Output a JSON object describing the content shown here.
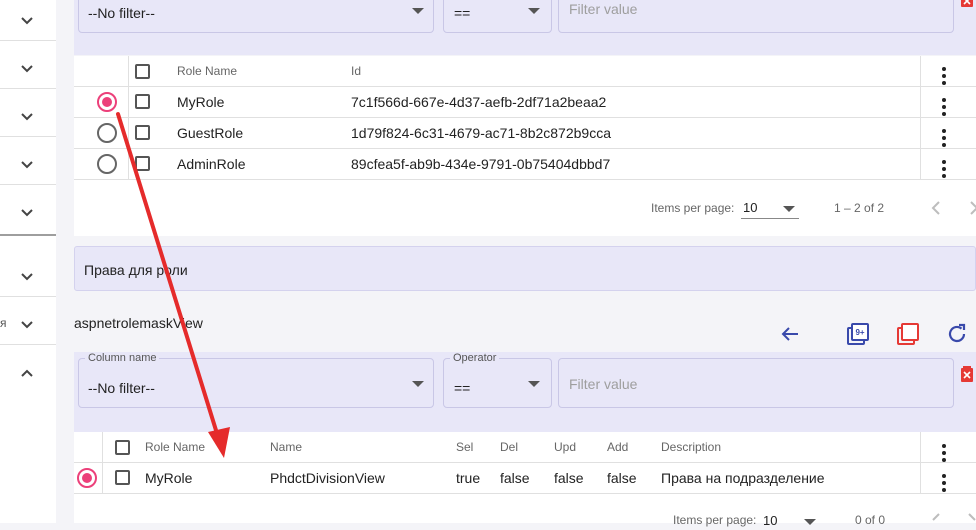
{
  "sidebar": {
    "partial_label": "я",
    "chevrons": [
      "chevron-down",
      "chevron-down",
      "chevron-down",
      "chevron-down",
      "chevron-down",
      "chevron-down",
      "chevron-down",
      "chevron-up"
    ]
  },
  "top_filter": {
    "column_value": "--No filter--",
    "operator_value": "==",
    "value_placeholder": "Filter value"
  },
  "roles_table": {
    "headers": {
      "role_name": "Role Name",
      "id": "Id"
    },
    "rows": [
      {
        "role_name": "MyRole",
        "id": "7c1f566d-667e-4d37-aefb-2df71a2beaa2",
        "selected": true
      },
      {
        "role_name": "GuestRole",
        "id": "1d79f824-6c31-4679-ac71-8b2c872b9cca",
        "selected": false
      },
      {
        "role_name": "AdminRole",
        "id": "89cfea5f-ab9b-434e-9791-0b75404dbbd7",
        "selected": false
      }
    ],
    "pager": {
      "items_label": "Items per page:",
      "page_size": "10",
      "range": "1 – 2 of 2"
    }
  },
  "permissions_section": {
    "title": "Права для роли"
  },
  "mask_view": {
    "title": "aspnetrolemaskView",
    "filter": {
      "column_label": "Column name",
      "column_value": "--No filter--",
      "operator_label": "Operator",
      "operator_value": "==",
      "value_placeholder": "Filter value"
    },
    "headers": {
      "role_name": "Role Name",
      "name": "Name",
      "sel": "Sel",
      "del": "Del",
      "upd": "Upd",
      "add": "Add",
      "description": "Description"
    },
    "rows": [
      {
        "role_name": "MyRole",
        "name": "PhdctDivisionView",
        "sel": "true",
        "del": "false",
        "upd": "false",
        "add": "false",
        "description": "Права на подразделение",
        "selected": true
      }
    ],
    "pager": {
      "items_label": "Items per page:",
      "page_size": "10",
      "range": "0 of 0"
    }
  },
  "colors": {
    "accent": "#ec407a",
    "primary_icon": "#3949ab",
    "danger_icon": "#e53935",
    "arrow": "#e52b2b",
    "filter_band": "#e8e7f8"
  }
}
